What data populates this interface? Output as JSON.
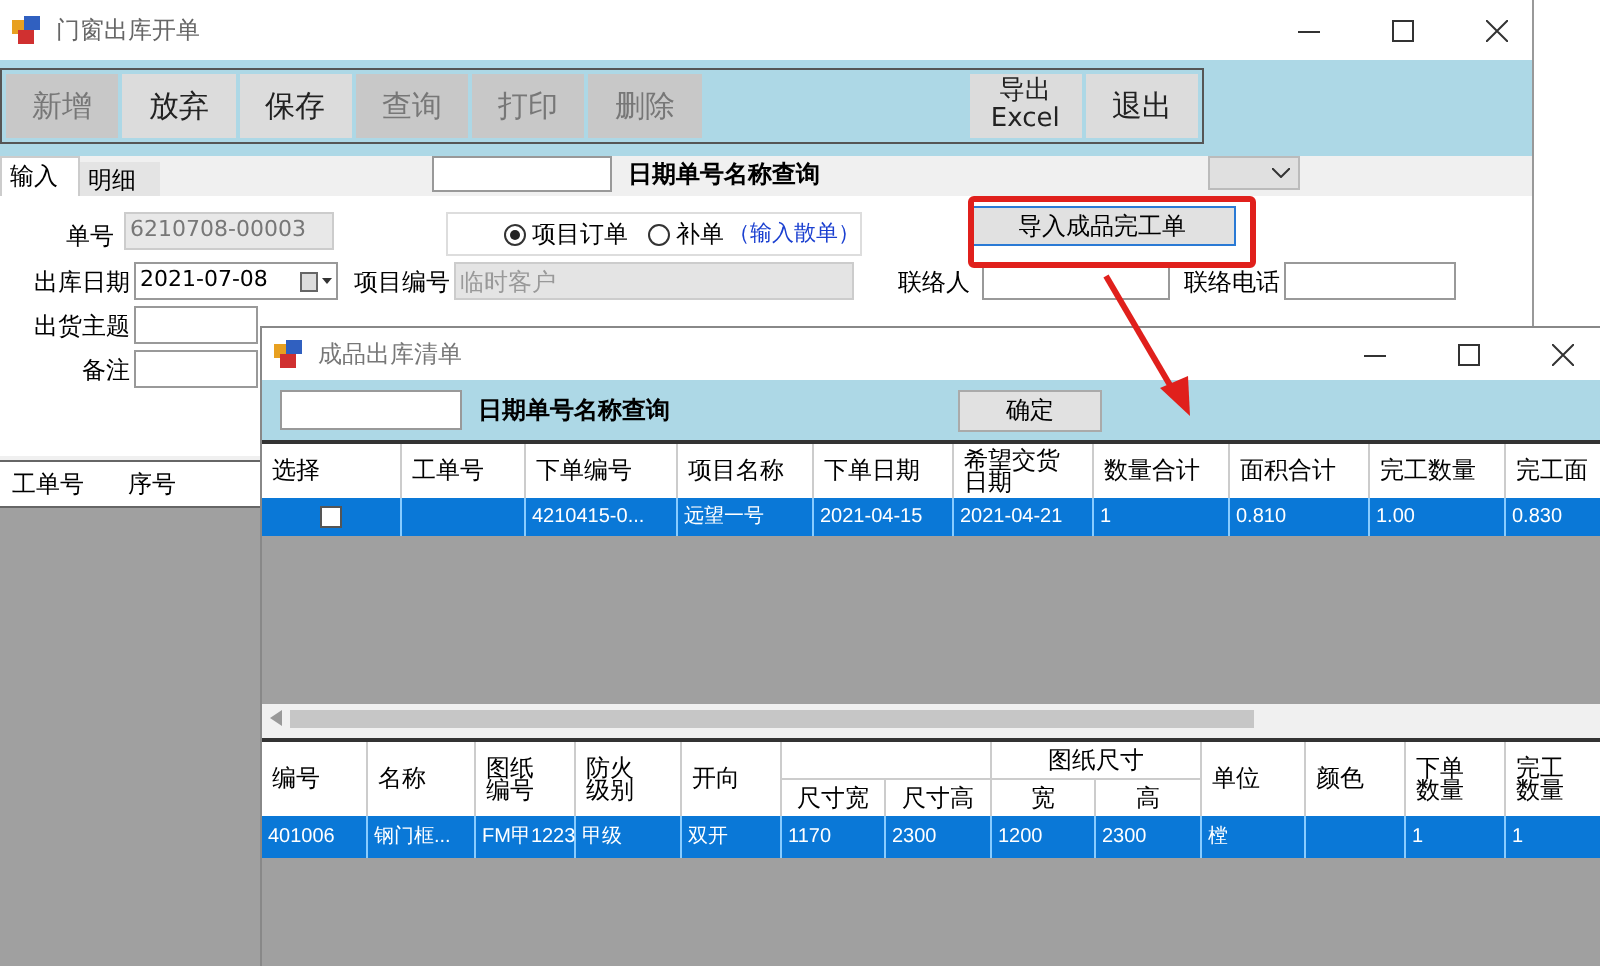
{
  "window": {
    "title": "门窗出库开单"
  },
  "toolbar": [
    {
      "label": "新增",
      "disabled": true
    },
    {
      "label": "放弃",
      "disabled": false
    },
    {
      "label": "保存",
      "disabled": false
    },
    {
      "label": "查询",
      "disabled": true
    },
    {
      "label": "打印",
      "disabled": true
    },
    {
      "label": "删除",
      "disabled": true
    },
    {
      "label": "导出\nExcel",
      "disabled": false
    },
    {
      "label": "退出",
      "disabled": false
    }
  ],
  "tabs": [
    {
      "label": "输入",
      "selected": true
    },
    {
      "label": "明细",
      "selected": false
    }
  ],
  "search_label": "日期单号名称查询",
  "form": {
    "order_no": {
      "label": "单号",
      "value": "6210708-00003"
    },
    "date": {
      "label": "出库日期",
      "value": "2021-07-08"
    },
    "subject": {
      "label": "出货主题"
    },
    "note": {
      "label": "备注"
    },
    "order_type": [
      {
        "label": "项目订单",
        "selected": true
      },
      {
        "label": "补单",
        "selected": false
      }
    ],
    "scatter_link": "（输入散单）",
    "project": {
      "label": "项目编号",
      "value": "临时客户"
    },
    "contact": {
      "label": "联络人"
    },
    "phone": {
      "label": "联络电话"
    },
    "import_button": "导入成品完工单"
  },
  "main_grid": {
    "columns": [
      "工单号",
      "序号"
    ]
  },
  "dialog": {
    "title": "成品出库清单",
    "search_label": "日期单号名称查询",
    "ok_button": "确定",
    "grid": {
      "columns": [
        "选择",
        "工单号",
        "下单编号",
        "项目名称",
        "下单日期",
        "希望交货日期",
        "数量合计",
        "面积合计",
        "完工数量",
        "完工面"
      ],
      "rows": [
        {
          "selected": true,
          "checked": false,
          "cells": [
            "",
            "",
            "4210415-0...",
            "远望一号",
            "2021-04-15",
            "2021-04-21",
            "1",
            "0.810",
            "1.00",
            "0.830"
          ]
        }
      ]
    },
    "detail": {
      "group": "图纸尺寸",
      "columns": [
        "编号",
        "名称",
        "图纸编号",
        "防火级别",
        "开向",
        "尺寸宽",
        "尺寸高",
        "宽",
        "高",
        "单位",
        "颜色",
        "下单数量",
        "完工数量"
      ],
      "rows": [
        {
          "selected": true,
          "cells": [
            "401006",
            "钢门框...",
            "FM甲1223",
            "甲级",
            "双开",
            "1170",
            "2300",
            "1200",
            "2300",
            "樘",
            "",
            "1",
            "1"
          ]
        }
      ]
    }
  }
}
